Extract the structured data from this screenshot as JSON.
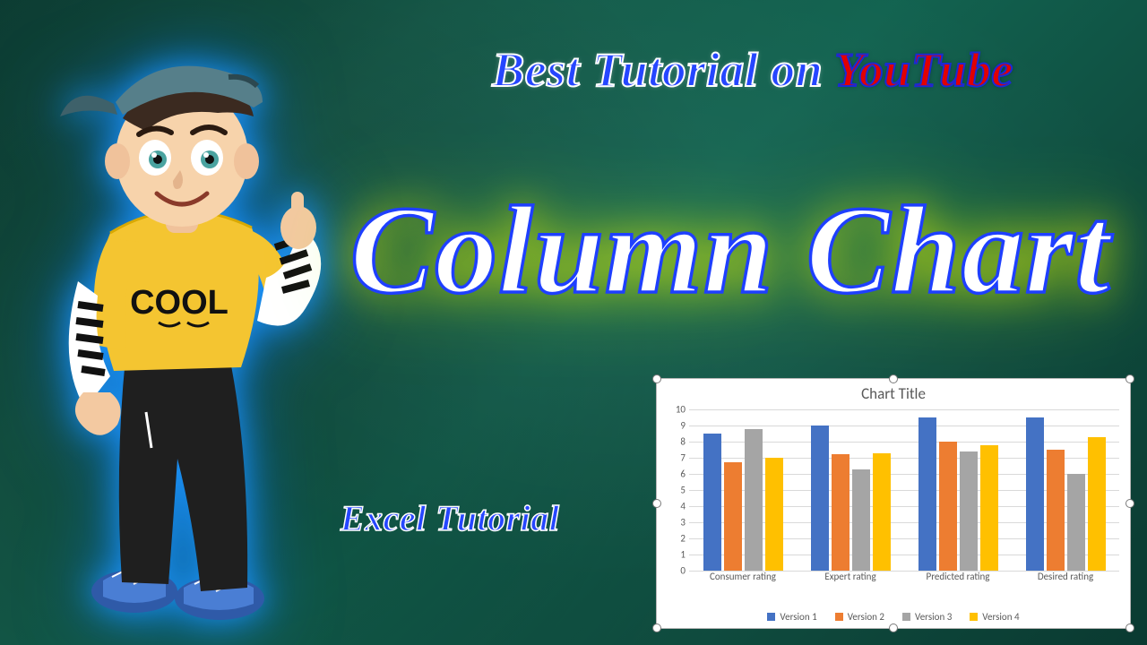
{
  "headline": {
    "part1": "Best Tutorial on ",
    "part2": "YouTube"
  },
  "main_title": "Column Chart",
  "subtitle": "Excel Tutorial",
  "character": {
    "shirt_text": "COOL"
  },
  "chart_data": {
    "type": "bar",
    "title": "Chart Title",
    "xlabel": "",
    "ylabel": "",
    "ylim": [
      0,
      10
    ],
    "yticks": [
      0,
      1,
      2,
      3,
      4,
      5,
      6,
      7,
      8,
      9,
      10
    ],
    "categories": [
      "Consumer rating",
      "Expert rating",
      "Predicted rating",
      "Desired rating"
    ],
    "series": [
      {
        "name": "Version 1",
        "color": "#4472c4",
        "values": [
          8.5,
          9.0,
          9.5,
          9.5
        ]
      },
      {
        "name": "Version 2",
        "color": "#ed7d31",
        "values": [
          6.7,
          7.2,
          8.0,
          7.5
        ]
      },
      {
        "name": "Version 3",
        "color": "#a5a5a5",
        "values": [
          8.8,
          6.3,
          7.4,
          6.0
        ]
      },
      {
        "name": "Version 4",
        "color": "#ffc000",
        "values": [
          7.0,
          7.3,
          7.8,
          8.3
        ]
      }
    ]
  }
}
